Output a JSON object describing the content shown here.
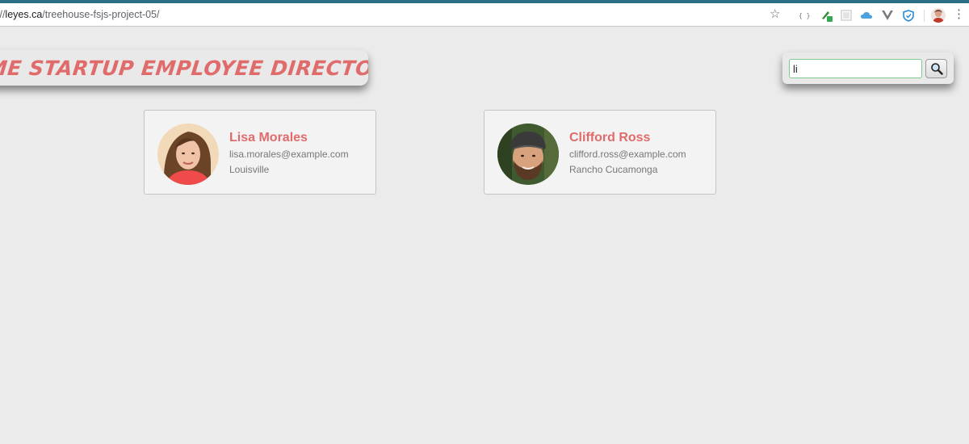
{
  "browser": {
    "url_prefix": "://",
    "url_host": "leyes.ca",
    "url_path": "/treehouse-fsjs-project-05/",
    "extensions": [
      "code-icon",
      "pen-extension-icon",
      "grid-extension-icon",
      "cloud-extension-icon",
      "vue-extension-icon",
      "shield-extension-icon"
    ]
  },
  "header": {
    "title": "ME STARTUP EMPLOYEE DIRECTORY"
  },
  "search": {
    "value": "li",
    "placeholder": ""
  },
  "employees": [
    {
      "name": "Lisa Morales",
      "email": "lisa.morales@example.com",
      "city": "Louisville"
    },
    {
      "name": "Clifford Ross",
      "email": "clifford.ross@example.com",
      "city": "Rancho Cucamonga"
    }
  ],
  "colors": {
    "accent": "#e06b6b",
    "background": "#ebebeb",
    "card": "#f3f3f3",
    "search_border": "#7fc88f"
  }
}
